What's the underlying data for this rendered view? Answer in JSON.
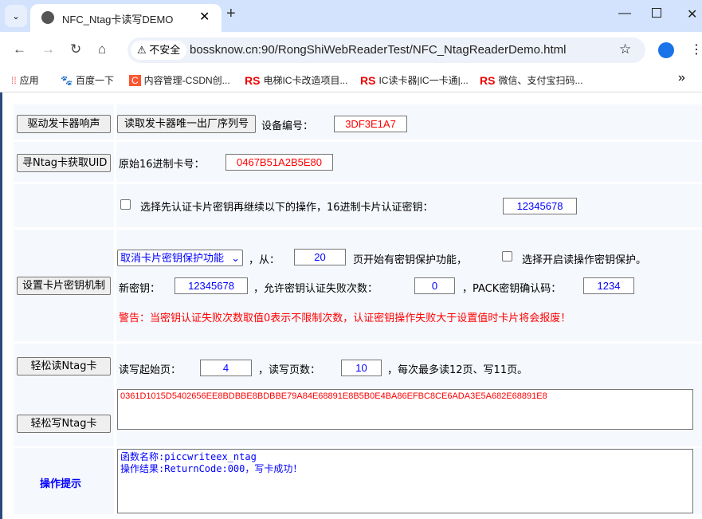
{
  "browser": {
    "tab_title": "NFC_Ntag卡读写DEMO",
    "security_label": "不安全",
    "url": "bossknow.cn:90/RongShiWebReaderTest/NFC_NtagReaderDemo.html",
    "bookmarks": [
      {
        "label": "应用",
        "icon": "apps-grid-icon"
      },
      {
        "label": "百度一下",
        "icon": "baidu-paw-icon"
      },
      {
        "label": "内容管理-CSDN创...",
        "icon": "csdn-c-icon",
        "icon_text": "C"
      },
      {
        "label": "电梯IC卡改造项目...",
        "icon": "rs-logo-icon",
        "icon_text": "RS"
      },
      {
        "label": "IC读卡器|IC一卡通|...",
        "icon": "rs-logo-icon",
        "icon_text": "RS"
      },
      {
        "label": "微信、支付宝扫码...",
        "icon": "rs-logo-icon",
        "icon_text": "RS"
      }
    ],
    "more": "»"
  },
  "page": {
    "beep_button": "驱动发卡器响声",
    "serial_button": "读取发卡器唯一出厂序列号",
    "device_label": "设备编号：",
    "device_value": "3DF3E1A7",
    "uid_button": "寻Ntag卡获取UID",
    "uid_label": "原始16进制卡号：",
    "uid_value": "0467B51A2B5E80",
    "auth_label": "选择先认证卡片密钥再继续以下的操作，16进制卡片认证密钥：",
    "auth_key": "12345678",
    "setkey_button": "设置卡片密钥机制",
    "protect_select": "取消卡片密钥保护功能",
    "from_label": "，从：",
    "from_page": "20",
    "from_suffix": "页开始有密钥保护功能，",
    "read_protect_label": "选择开启读操作密钥保护。",
    "newkey_label": "新密钥：",
    "newkey_value": "12345678",
    "fail_label": "，允许密钥认证失败次数：",
    "fail_value": "0",
    "pack_label": "，PACK密钥确认码：",
    "pack_value": "1234",
    "warning": "警告：当密钥认证失败次数取值0表示不限制次数，认证密钥操作失败大于设置值时卡片将会报废！",
    "read_button": "轻松读Ntag卡",
    "start_label": "读写起始页：",
    "start_value": "4",
    "count_label": "，读写页数：",
    "count_value": "10",
    "limit_note": "，每次最多读12页、写11页。",
    "write_button": "轻松写Ntag卡",
    "data_value": "0361D1015D5402656EE8BDBBE8BDBBE79A84E68891E8B5B0E4BA86EFBC8CE6ADA3E5A682E68891E8",
    "status_label": "操作提示",
    "status_text": "函数名称:piccwriteex_ntag\n操作结果:ReturnCode:000，写卡成功！"
  }
}
